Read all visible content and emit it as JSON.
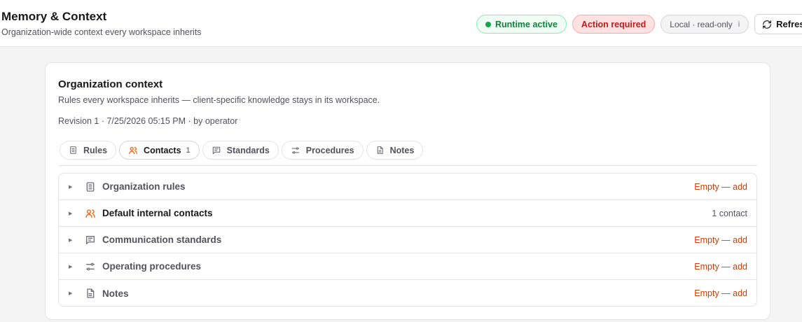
{
  "header": {
    "title": "Memory & Context",
    "subtitle": "Organization-wide context every workspace inherits",
    "runtime_status": "Runtime active",
    "action_status": "Action required",
    "mode": "Local · read-only",
    "mode_info": "i",
    "refresh_label": "Refresh"
  },
  "card": {
    "title": "Organization context",
    "description": "Rules every workspace inherits — client-specific knowledge stays in its workspace.",
    "revision": "Revision 1 · 7/25/2026 05:15 PM · by operator"
  },
  "tabs": [
    {
      "label": "Rules",
      "icon": "document-icon"
    },
    {
      "label": "Contacts",
      "icon": "users-icon",
      "count": "1",
      "active": true
    },
    {
      "label": "Standards",
      "icon": "message-icon"
    },
    {
      "label": "Procedures",
      "icon": "sliders-icon"
    },
    {
      "label": "Notes",
      "icon": "note-icon"
    }
  ],
  "sections": [
    {
      "label": "Organization rules",
      "icon": "document-icon",
      "status": "Empty — add"
    },
    {
      "label": "Default internal contacts",
      "icon": "users-icon",
      "status": "1 contact"
    },
    {
      "label": "Communication standards",
      "icon": "message-icon",
      "status": "Empty — add"
    },
    {
      "label": "Operating procedures",
      "icon": "sliders-icon",
      "status": "Empty — add"
    },
    {
      "label": "Notes",
      "icon": "note-icon",
      "status": "Empty — add"
    }
  ],
  "colors": {
    "accent_empty": "#c2410c",
    "contacts_icon": "#ea580c",
    "runtime_green": "#16a34a",
    "action_red": "#b91c1c"
  }
}
